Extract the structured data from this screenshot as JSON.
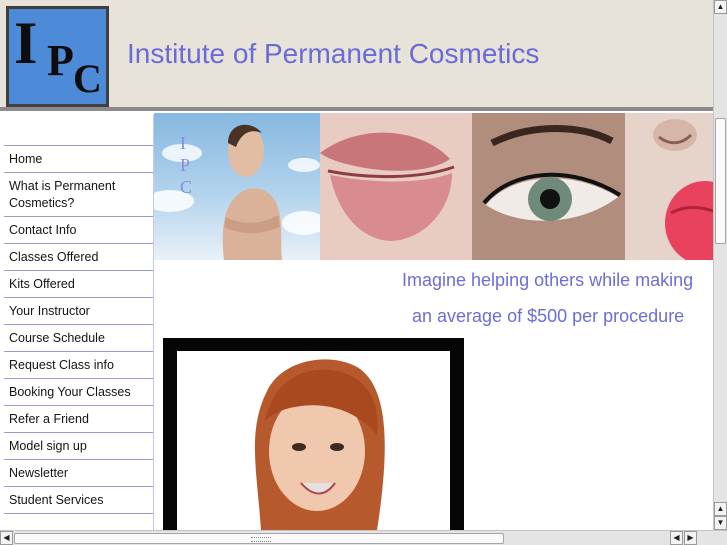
{
  "header": {
    "logo_letters": [
      "I",
      "P",
      "C"
    ],
    "title": "Institute of Permanent Cosmetics"
  },
  "banner": {
    "side_letters": [
      "I",
      "P",
      "C"
    ]
  },
  "sidebar": {
    "items": [
      {
        "label": "Home"
      },
      {
        "label": "What is Permanent Cosmetics?"
      },
      {
        "label": "Contact Info"
      },
      {
        "label": "Classes Offered"
      },
      {
        "label": "Kits Offered"
      },
      {
        "label": "Your Instructor"
      },
      {
        "label": "Course Schedule"
      },
      {
        "label": "Request Class info"
      },
      {
        "label": "Booking Your Classes"
      },
      {
        "label": "Refer a Friend"
      },
      {
        "label": "Model sign up"
      },
      {
        "label": "Newsletter"
      },
      {
        "label": "Student Services"
      }
    ]
  },
  "main": {
    "tagline_1": "Imagine helping others while making",
    "tagline_2": "an average of $500 per procedure"
  },
  "scroll": {
    "up": "▲",
    "down": "▼",
    "left": "◀",
    "right": "▶"
  },
  "colors": {
    "accent": "#6a6ad8",
    "logo_bg": "#4d8ad7",
    "header_bg": "#e7e3d8"
  }
}
